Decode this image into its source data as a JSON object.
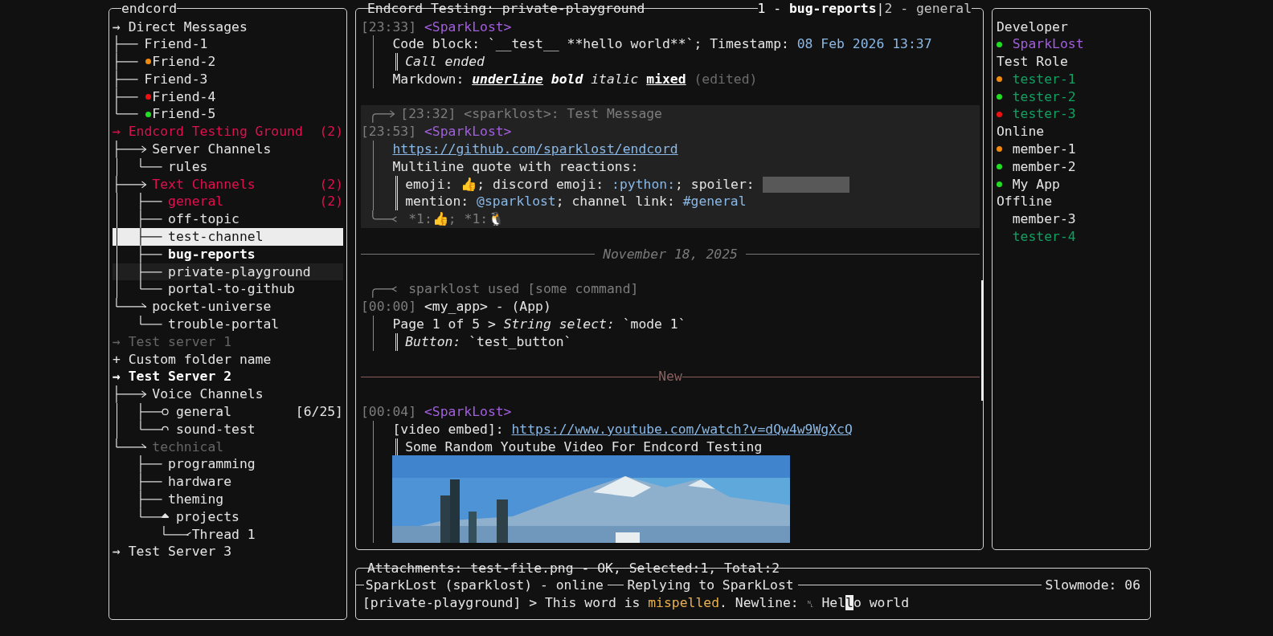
{
  "sidebar": {
    "title": "endcord",
    "tree": [
      {
        "kind": "root",
        "marker": "→",
        "label": "Direct Messages",
        "unread": false,
        "muted": false,
        "active": false,
        "selected": false,
        "children": [
          {
            "kind": "line",
            "label": "Friend-1",
            "selected": false
          },
          {
            "kind": "line",
            "label": "Friend-2",
            "color": "#f08a10",
            "selected": false
          },
          {
            "kind": "line",
            "label": "Friend-3",
            "selected": false
          },
          {
            "kind": "line",
            "label": "Friend-4",
            "color": "#ee1111",
            "selected": false
          },
          {
            "kind": "line",
            "label": "Friend-5",
            "color": "#22dd22",
            "selected": false
          }
        ]
      },
      {
        "kind": "root",
        "marker": "→",
        "label": "Endcord Testing Ground",
        "unread": true,
        "muted": false,
        "active": false,
        "badge": "(2)",
        "selected": false,
        "children": [
          {
            "kind": "arrow",
            "label": "Server Channels",
            "unread": false,
            "selected": false,
            "children": [
              {
                "kind": "line",
                "label": "rules",
                "selected": false
              }
            ]
          },
          {
            "kind": "arrow",
            "label": "Text Channels",
            "unread": true,
            "badge": "(2)",
            "selected": false,
            "children": [
              {
                "kind": "line",
                "label": "general",
                "unread": true,
                "active": false,
                "hovered": false,
                "badge": "(2)",
                "selected": false
              },
              {
                "kind": "line",
                "label": "off-topic",
                "unread": false,
                "active": false,
                "hovered": false,
                "selected": false
              },
              {
                "kind": "line",
                "label": "test-channel",
                "unread": false,
                "active": false,
                "hovered": false,
                "selected": true
              },
              {
                "kind": "line",
                "label": "bug-reports",
                "unread": false,
                "active": true,
                "hovered": false,
                "selected": false
              },
              {
                "kind": "line",
                "label": "private-playground",
                "unread": false,
                "active": false,
                "hovered": true,
                "selected": false
              },
              {
                "kind": "line",
                "label": "portal-to-github",
                "unread": false,
                "active": false,
                "hovered": false,
                "selected": false
              }
            ]
          },
          {
            "kind": "arrow",
            "label": "pocket-universe",
            "unread": false,
            "selected": false,
            "children": [
              {
                "kind": "line",
                "label": "trouble-portal",
                "selected": false
              }
            ]
          }
        ]
      },
      {
        "kind": "root",
        "marker": "→",
        "label": "Test server 1",
        "unread": false,
        "muted": true,
        "active": false,
        "selected": false
      },
      {
        "kind": "root",
        "marker": "+",
        "label": "Custom folder name",
        "unread": false,
        "muted": false,
        "active": false,
        "selected": false
      },
      {
        "kind": "root",
        "marker": "→",
        "label": "Test Server 2",
        "unread": false,
        "muted": false,
        "active": true,
        "selected": false,
        "children": [
          {
            "kind": "arrow",
            "label": "Voice Channels",
            "muted": false,
            "selected": false,
            "children": [
              {
                "kind": "circle",
                "label": "general",
                "badge": "[6/25]",
                "selected": false
              },
              {
                "kind": "circle",
                "label": "sound-test",
                "selected": false
              }
            ]
          },
          {
            "kind": "arrow",
            "label": "technical",
            "muted": true,
            "selected": false,
            "children": [
              {
                "kind": "line",
                "label": "programming",
                "selected": false
              },
              {
                "kind": "line",
                "label": "hardware",
                "selected": false
              },
              {
                "kind": "line",
                "label": "theming",
                "selected": false
              },
              {
                "kind": "diamond",
                "label": "projects",
                "selected": false,
                "children": [
                  {
                    "kind": "chevron",
                    "label": "Thread 1",
                    "selected": false
                  }
                ]
              }
            ]
          }
        ]
      },
      {
        "kind": "root",
        "marker": "→",
        "label": "Test Server 3",
        "unread": false,
        "muted": false,
        "active": false,
        "selected": false
      }
    ]
  },
  "chat": {
    "title": "Endcord Testing: private-playground",
    "tabs": [
      {
        "index": "1 -",
        "name": "bug-reports",
        "selected": true
      },
      {
        "index": "2 -",
        "name": "general",
        "selected": false
      }
    ],
    "tab_separator": "|",
    "items": [
      {
        "kind": "message",
        "selected": false,
        "time": "[23:33]",
        "author": "<SparkLost>",
        "color": "#a35ee0",
        "lines": [
          {
            "kind": "text",
            "segments": [
              {
                "kind": "plain",
                "text": "Code block: `__test__ **hello world**`; Timestamp: "
              },
              {
                "kind": "accent",
                "text": "08 Feb 2026 13:37"
              }
            ]
          },
          {
            "kind": "quote",
            "segments": [
              {
                "kind": "italic",
                "text": "Call ended"
              }
            ]
          },
          {
            "kind": "text",
            "segments": [
              {
                "kind": "plain",
                "text": "Markdown: "
              },
              {
                "kind": "bold-italic-underline",
                "text": "underline"
              },
              {
                "kind": "bold-italic",
                "text": " bold"
              },
              {
                "kind": "italic",
                "text": " italic "
              },
              {
                "kind": "bold-underline",
                "text": "mixed"
              },
              {
                "kind": "muted",
                "text": " (edited)"
              }
            ]
          }
        ]
      },
      {
        "kind": "message",
        "selected": true,
        "reply": {
          "kind": "reply",
          "text": "[23:32] <sparklost>: Test Message"
        },
        "time": "[23:53]",
        "author": "<SparkLost>",
        "color": "#a35ee0",
        "lines": [
          {
            "kind": "text",
            "segments": [
              {
                "kind": "link",
                "text": "https://github.com/sparklost/endcord"
              }
            ]
          },
          {
            "kind": "text",
            "segments": [
              {
                "kind": "plain",
                "text": "Multiline quote with reactions:"
              }
            ]
          },
          {
            "kind": "quote",
            "segments": [
              {
                "kind": "plain",
                "text": "emoji: 👍; discord emoji: "
              },
              {
                "kind": "accent",
                "text": ":python:"
              },
              {
                "kind": "plain",
                "text": "; spoiler: "
              },
              {
                "kind": "spoiler"
              }
            ]
          },
          {
            "kind": "quote",
            "segments": [
              {
                "kind": "plain",
                "text": "mention: "
              },
              {
                "kind": "accent",
                "text": "@sparklost"
              },
              {
                "kind": "plain",
                "text": "; channel link: "
              },
              {
                "kind": "accent",
                "text": "#general"
              }
            ]
          }
        ],
        "reactions": "*1:👍; *1:🐧"
      },
      {
        "kind": "date",
        "label": "November 18, 2025"
      },
      {
        "kind": "message",
        "selected": false,
        "reply": {
          "kind": "command",
          "text": "sparklost used [some command]"
        },
        "time": "[00:00]",
        "author": "<my_app>",
        "color": "#e6e6e6",
        "author_tag": "- (App)",
        "lines": [
          {
            "kind": "text",
            "segments": [
              {
                "kind": "plain",
                "text": "Page 1 of 5 > "
              },
              {
                "kind": "italic",
                "text": "String select:"
              },
              {
                "kind": "plain",
                "text": " `mode 1`"
              }
            ]
          },
          {
            "kind": "quote",
            "segments": [
              {
                "kind": "italic",
                "text": "Button:"
              },
              {
                "kind": "plain",
                "text": " `test_button`"
              }
            ]
          }
        ]
      },
      {
        "kind": "new",
        "label": "New"
      },
      {
        "kind": "message",
        "selected": false,
        "time": "[00:04]",
        "author": "<SparkLost>",
        "color": "#a35ee0",
        "lines": [
          {
            "kind": "text",
            "segments": [
              {
                "kind": "plain",
                "text": "[video embed]: "
              },
              {
                "kind": "link",
                "text": "https://www.youtube.com/watch?v=dQw4w9WgXcQ"
              }
            ]
          },
          {
            "kind": "quote",
            "segments": [
              {
                "kind": "plain",
                "text": "Some Random Youtube Video For Endcord Testing"
              }
            ]
          },
          {
            "kind": "picture"
          }
        ]
      }
    ]
  },
  "members": {
    "groups": [
      {
        "label": "Developer",
        "members": [
          {
            "name": "SparkLost",
            "color": "#22dd22",
            "kind": "developer"
          }
        ]
      },
      {
        "label": "Test Role",
        "members": [
          {
            "name": "tester-1",
            "color": "#f08a10",
            "kind": "tester"
          },
          {
            "name": "tester-2",
            "color": "#22dd22",
            "kind": "tester"
          },
          {
            "name": "tester-3",
            "color": "#ee1111",
            "kind": "tester"
          }
        ]
      },
      {
        "label": "Online",
        "members": [
          {
            "name": "member-1",
            "color": "#f08a10",
            "kind": "member"
          },
          {
            "name": "member-2",
            "color": "#22dd22",
            "kind": "member"
          },
          {
            "name": "My App",
            "color": "#22dd22",
            "kind": "member"
          }
        ]
      },
      {
        "label": "Offline",
        "members": [
          {
            "name": "member-3",
            "kind": "member"
          },
          {
            "name": "tester-4",
            "kind": "tester"
          }
        ]
      }
    ]
  },
  "composer": {
    "attachments": "Attachments: test-file.png - OK, Selected:1, Total:2",
    "status": {
      "user": "SparkLost (sparklost) - online",
      "reply": "Replying to SparkLost",
      "slowmode": "Slowmode: 06"
    },
    "input": [
      {
        "kind": "plain",
        "text": "[private-playground] > This word is "
      },
      {
        "kind": "misspelled",
        "text": "mispelled"
      },
      {
        "kind": "plain",
        "text": ". Newline: "
      },
      {
        "kind": "symbol",
        "text": "␤"
      },
      {
        "kind": "plain",
        "text": " Hel"
      },
      {
        "kind": "cursor",
        "text": "l"
      },
      {
        "kind": "plain",
        "text": "o world"
      }
    ]
  }
}
